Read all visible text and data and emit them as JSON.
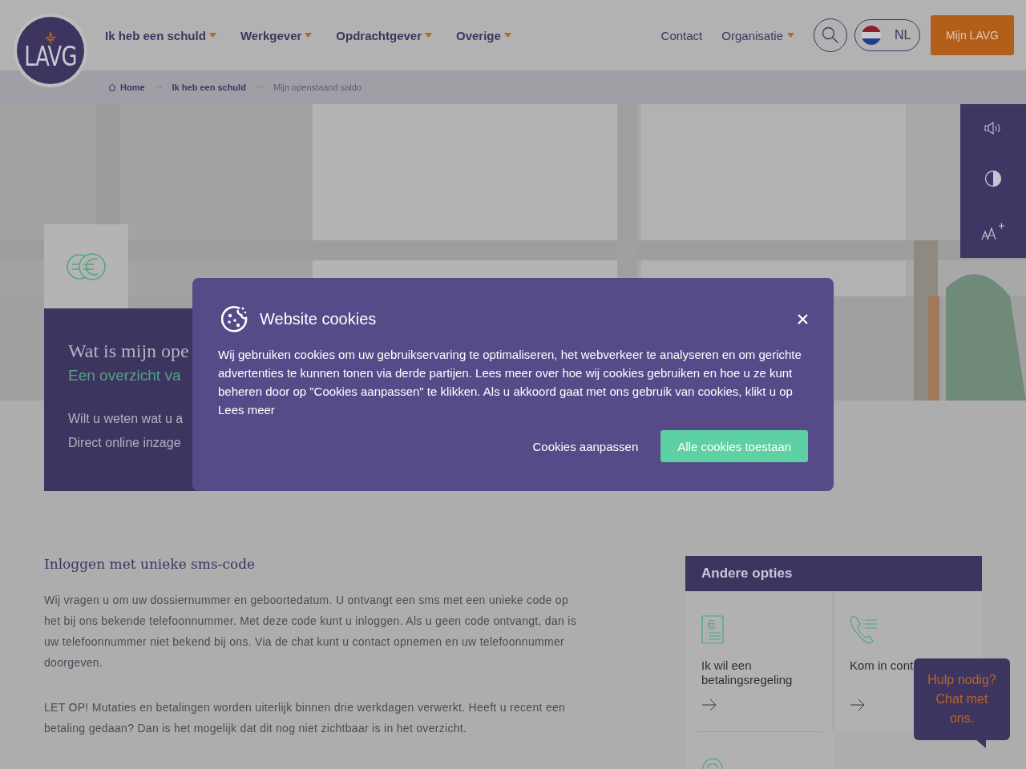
{
  "header": {
    "logo": "LAVG",
    "nav": [
      {
        "label": "Ik heb een schuld",
        "dropdown": true
      },
      {
        "label": "Werkgever",
        "dropdown": true
      },
      {
        "label": "Opdrachtgever",
        "dropdown": true
      },
      {
        "label": "Overige",
        "dropdown": true
      }
    ],
    "links": [
      {
        "label": "Contact",
        "dropdown": false
      },
      {
        "label": "Organisatie",
        "dropdown": true
      }
    ],
    "language": "NL",
    "account_button": "Mijn LAVG"
  },
  "breadcrumb": [
    {
      "label": "Home",
      "kind": "home"
    },
    {
      "label": "Ik heb een schuld",
      "kind": "link"
    },
    {
      "label": "Mijn openstaand saldo",
      "kind": "current"
    }
  ],
  "hero": {
    "title": "Wat is mijn ope",
    "subtitle": "Een overzicht va",
    "lines": [
      "Wilt u weten wat u a",
      "Direct online inzage"
    ]
  },
  "content": {
    "heading": "Inloggen met unieke sms-code",
    "paragraphs": [
      "Wij vragen u om uw dossiernummer en geboortedatum. U ontvangt een sms met een unieke code op het bij ons bekende telefoonnummer. Met deze code kunt u inloggen. Als u geen code ontvangt, dan is uw telefoonnummer niet bekend bij ons. Via de chat kunt u contact opnemen en uw telefoonnummer doorgeven.",
      "LET OP! Mutaties en betalingen worden uiterlijk binnen drie werkdagen verwerkt. Heeft u recent een betaling gedaan? Dan is het mogelijk dat dit nog niet zichtbaar is in het overzicht."
    ]
  },
  "sidebar": {
    "title": "Andere opties",
    "options": [
      {
        "label": "Ik wil een betalingsregeling",
        "kind": "payment"
      },
      {
        "label": "Kom in cont",
        "kind": "contact"
      },
      {
        "kind": "chat"
      }
    ]
  },
  "chat": {
    "text": "Hulp nodig? Chat met ons."
  },
  "cookie_dialog": {
    "title": "Website cookies",
    "body": "Wij gebruiken cookies om uw gebruikservaring te optimaliseren, het webverkeer te analyseren en om gerichte advertenties te kunnen tonen via derde partijen. Lees meer over hoe wij cookies gebruiken en hoe u ze kunt beheren door op \"Cookies aanpassen\" te klikken. Als u akkoord gaat met ons gebruik van cookies, klikt u op",
    "link": "Lees meer",
    "buttons": [
      {
        "label": "Cookies aanpassen",
        "kind": "secondary"
      },
      {
        "label": "Alle cookies toestaan",
        "kind": "primary"
      }
    ]
  }
}
